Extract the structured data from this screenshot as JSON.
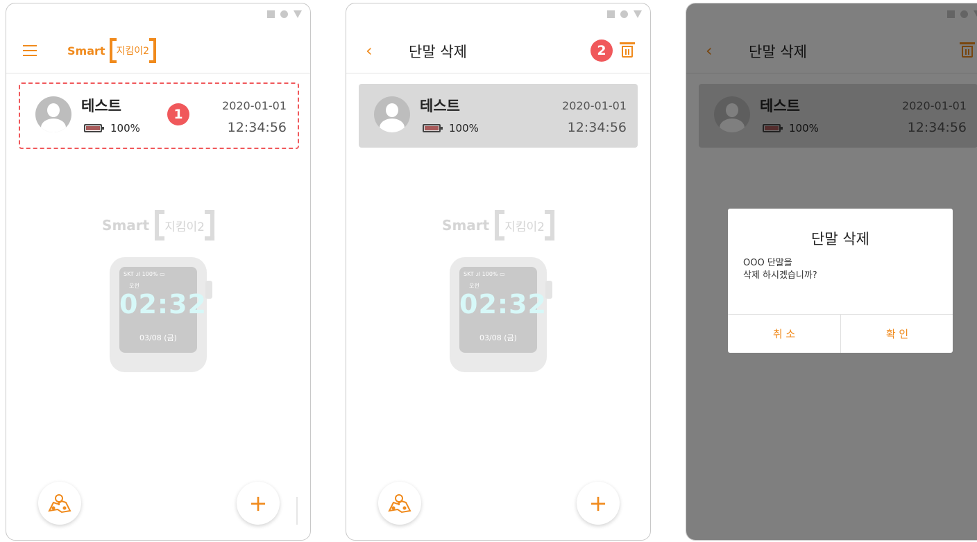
{
  "colors": {
    "accent": "#f08a1c",
    "badge": "#f0585b",
    "selected": "#d9d9d9"
  },
  "logo": {
    "smart": "Smart",
    "brand": "지킴이2"
  },
  "device": {
    "name": "테스트",
    "battery": "100%",
    "date": "2020-01-01",
    "time": "12:34:56"
  },
  "watch": {
    "signal": "SKT  .ıl 100% ▭",
    "ampm": "오전",
    "time": "02:32",
    "date": "03/08 (금)"
  },
  "screen2": {
    "title": "단말 삭제"
  },
  "screen3": {
    "title": "단말 삭제"
  },
  "badges": {
    "one": "1",
    "two": "2"
  },
  "dialog": {
    "title": "단말 삭제",
    "line1": "OOO 단말을",
    "line2": "삭제 하시겠습니까?",
    "cancel": "취 소",
    "ok": "확 인"
  },
  "fab": {
    "add": "+",
    "map_icon": "map-icon"
  }
}
